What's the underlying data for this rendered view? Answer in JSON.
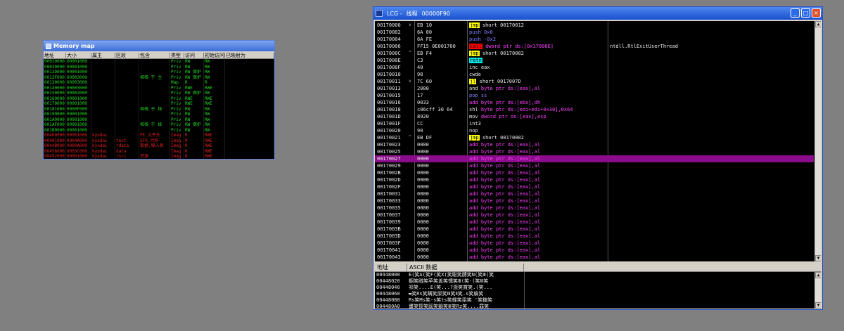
{
  "memory_map": {
    "title": "Memory map",
    "columns": [
      "地址",
      "大小",
      "属主",
      "区段",
      "包含",
      "类型",
      "访问",
      "初始访问",
      "已映射为"
    ],
    "rows": [
      {
        "c": [
          "00010000",
          "00001000",
          "",
          "",
          "",
          "Priv",
          "RW",
          "RW",
          ""
        ],
        "t": "g"
      },
      {
        "c": [
          "00020000",
          "00001000",
          "",
          "",
          "",
          "Priv",
          "RW",
          "RW",
          ""
        ],
        "t": "g"
      },
      {
        "c": [
          "0012D000",
          "00001000",
          "",
          "",
          "",
          "Priv",
          "RW  保护",
          "RW",
          ""
        ],
        "t": "g"
      },
      {
        "c": [
          "0012F000",
          "00003000",
          "",
          "",
          "堆栈 于 主",
          "Priv",
          "RW  保护",
          "RW",
          ""
        ],
        "t": "g"
      },
      {
        "c": [
          "00130000",
          "00003000",
          "",
          "",
          "",
          "Map",
          "R",
          "R",
          ""
        ],
        "t": "g"
      },
      {
        "c": [
          "00140000",
          "00003000",
          "",
          "",
          "",
          "Priv",
          "RWE",
          "RWE",
          ""
        ],
        "t": "g"
      },
      {
        "c": [
          "00150000",
          "00002000",
          "",
          "",
          "",
          "Priv",
          "RW  保护",
          "RW",
          ""
        ],
        "t": "g"
      },
      {
        "c": [
          "00160000",
          "00001000",
          "",
          "",
          "",
          "Priv",
          "RWE",
          "RWE",
          ""
        ],
        "t": "g"
      },
      {
        "c": [
          "00170000",
          "00001000",
          "",
          "",
          "",
          "Priv",
          "RWE",
          "RWE",
          ""
        ],
        "t": "g"
      },
      {
        "c": [
          "00181000",
          "0000F000",
          "",
          "",
          "堆栈 于 线",
          "Priv",
          "RW",
          "RW",
          ""
        ],
        "t": "g"
      },
      {
        "c": [
          "00190000",
          "00001000",
          "",
          "",
          "",
          "Priv",
          "RW",
          "RW",
          ""
        ],
        "t": "g"
      },
      {
        "c": [
          "001A0000",
          "00001000",
          "",
          "",
          "",
          "Priv",
          "RW",
          "RW",
          ""
        ],
        "t": "g"
      },
      {
        "c": [
          "001AF000",
          "00001000",
          "",
          "",
          "堆栈 于 线",
          "Priv",
          "RW  保护",
          "RW",
          ""
        ],
        "t": "g"
      },
      {
        "c": [
          "001B0000",
          "00001000",
          "",
          "",
          "",
          "Priv",
          "RW",
          "RW",
          ""
        ],
        "t": "g"
      },
      {
        "c": [
          "00400000",
          "00001000",
          "kyodai",
          "",
          "PE 文件头",
          "Imag",
          "R",
          "RWE",
          ""
        ],
        "t": "r"
      },
      {
        "c": [
          "00401000",
          "0004A000",
          "kyodai",
          "text",
          "SFX,代码",
          "Imag",
          "R",
          "RWE",
          ""
        ],
        "t": "r"
      },
      {
        "c": [
          "0044B000",
          "0000A000",
          "kyodai",
          "rdata",
          "数据,输入表",
          "Imag",
          "R",
          "RWE",
          ""
        ],
        "t": "r"
      },
      {
        "c": [
          "00456000",
          "0003C000",
          "kyodai",
          "data",
          "",
          "Imag",
          "R",
          "RWE",
          ""
        ],
        "t": "r"
      },
      {
        "c": [
          "00492000",
          "00001000",
          "kyodai",
          "rsrc",
          "资源",
          "Imag",
          "R",
          "RWE",
          ""
        ],
        "t": "r"
      }
    ]
  },
  "cpu": {
    "title_prefix": "LCG -",
    "title_thread": "线程",
    "title_id": "00000F90",
    "buttons": {
      "min": "_",
      "max": "□",
      "close": "×"
    },
    "selected_index": 19,
    "rows": [
      {
        "addr": "00170000",
        "mark": "v",
        "hex": "EB 10",
        "mn": "jmp",
        "cls": "jmp",
        "op": "short 00170012",
        "ocls": "plain",
        "cmt": ""
      },
      {
        "addr": "00170002",
        "mark": "",
        "hex": "6A 00",
        "mn": "push",
        "cls": "push",
        "op": "0x0",
        "ocls": "push",
        "cmt": ""
      },
      {
        "addr": "00170004",
        "mark": "",
        "hex": "6A FE",
        "mn": "push",
        "cls": "push",
        "op": "-0x2",
        "ocls": "push",
        "cmt": ""
      },
      {
        "addr": "00170006",
        "mark": "",
        "hex": "FF15 0E001700",
        "mn": "call",
        "cls": "call",
        "op": "dword ptr ds:[0x17000E]",
        "ocls": "mem",
        "cmt": "ntdll.RtlExitUserThread"
      },
      {
        "addr": "0017000C",
        "mark": "^",
        "hex": "EB F4",
        "mn": "jmp",
        "cls": "jmp",
        "op": "short 00170002",
        "ocls": "plain",
        "cmt": ""
      },
      {
        "addr": "0017000E",
        "mark": "",
        "hex": "C3",
        "mn": "retn",
        "cls": "retn",
        "op": "",
        "ocls": "plain",
        "cmt": ""
      },
      {
        "addr": "0017000F",
        "mark": "",
        "hex": "40",
        "mn": "inc",
        "cls": "plain",
        "op": "eax",
        "ocls": "plain",
        "cmt": ""
      },
      {
        "addr": "00170010",
        "mark": "",
        "hex": "98",
        "mn": "cwde",
        "cls": "plain",
        "op": "",
        "ocls": "plain",
        "cmt": ""
      },
      {
        "addr": "00170011",
        "mark": "v",
        "hex": "7C 60",
        "mn": "jl",
        "cls": "jmp",
        "op": "short 0017007D",
        "ocls": "plain",
        "cmt": ""
      },
      {
        "addr": "00170013",
        "mark": "",
        "hex": "2000",
        "mn": "and",
        "cls": "plain",
        "op": "byte ptr ds:[eax],al",
        "ocls": "mem",
        "cmt": ""
      },
      {
        "addr": "00170015",
        "mark": "",
        "hex": "17",
        "mn": "pop",
        "cls": "push",
        "op": "ss",
        "ocls": "push",
        "cmt": ""
      },
      {
        "addr": "00170016",
        "mark": "",
        "hex": "0033",
        "mn": "add",
        "cls": "add",
        "op": "byte ptr ds:[ebx],dh",
        "ocls": "mem",
        "cmt": ""
      },
      {
        "addr": "00170018",
        "mark": "",
        "hex": "c06cff 30 64",
        "mn": "shl",
        "cls": "plain",
        "op": "byte ptr ds:[edi+edi+0x30],0x64",
        "ocls": "mem",
        "cmt": ""
      },
      {
        "addr": "0017001D",
        "mark": "",
        "hex": "8920",
        "mn": "mov",
        "cls": "plain",
        "op": "dword ptr ds:[eax],esp",
        "ocls": "mem",
        "cmt": ""
      },
      {
        "addr": "0017001F",
        "mark": "",
        "hex": "CC",
        "mn": "int3",
        "cls": "plain",
        "op": "",
        "ocls": "plain",
        "cmt": ""
      },
      {
        "addr": "00170020",
        "mark": "",
        "hex": "90",
        "mn": "nop",
        "cls": "plain",
        "op": "",
        "ocls": "plain",
        "cmt": ""
      },
      {
        "addr": "00170021",
        "mark": "^",
        "hex": "EB DF",
        "mn": "jmp",
        "cls": "jmp",
        "op": "short 00170002",
        "ocls": "plain",
        "cmt": ""
      },
      {
        "addr": "00170023",
        "mark": "",
        "hex": "0000",
        "mn": "add",
        "cls": "add",
        "op": "byte ptr ds:[eax],al",
        "ocls": "mem",
        "cmt": ""
      },
      {
        "addr": "00170025",
        "mark": "",
        "hex": "0000",
        "mn": "add",
        "cls": "add",
        "op": "byte ptr ds:[eax],al",
        "ocls": "mem",
        "cmt": ""
      },
      {
        "addr": "00170027",
        "mark": "",
        "hex": "0000",
        "mn": "add",
        "cls": "add",
        "op": "byte ptr ds:[eax],al",
        "ocls": "mem",
        "cmt": ""
      },
      {
        "addr": "00170029",
        "mark": "",
        "hex": "0000",
        "mn": "add",
        "cls": "add",
        "op": "byte ptr ds:[eax],al",
        "ocls": "mem",
        "cmt": ""
      },
      {
        "addr": "0017002B",
        "mark": "",
        "hex": "0000",
        "mn": "add",
        "cls": "add",
        "op": "byte ptr ds:[eax],al",
        "ocls": "mem",
        "cmt": ""
      },
      {
        "addr": "0017002D",
        "mark": "",
        "hex": "0000",
        "mn": "add",
        "cls": "add",
        "op": "byte ptr ds:[eax],al",
        "ocls": "mem",
        "cmt": ""
      },
      {
        "addr": "0017002F",
        "mark": "",
        "hex": "0000",
        "mn": "add",
        "cls": "add",
        "op": "byte ptr ds:[eax],al",
        "ocls": "mem",
        "cmt": ""
      },
      {
        "addr": "00170031",
        "mark": "",
        "hex": "0000",
        "mn": "add",
        "cls": "add",
        "op": "byte ptr ds:[eax],al",
        "ocls": "mem",
        "cmt": ""
      },
      {
        "addr": "00170033",
        "mark": "",
        "hex": "0000",
        "mn": "add",
        "cls": "add",
        "op": "byte ptr ds:[eax],al",
        "ocls": "mem",
        "cmt": ""
      },
      {
        "addr": "00170035",
        "mark": "",
        "hex": "0000",
        "mn": "add",
        "cls": "add",
        "op": "byte ptr ds:[eax],al",
        "ocls": "mem",
        "cmt": ""
      },
      {
        "addr": "00170037",
        "mark": "",
        "hex": "0000",
        "mn": "add",
        "cls": "add",
        "op": "byte ptr ds:[eax],al",
        "ocls": "mem",
        "cmt": ""
      },
      {
        "addr": "00170039",
        "mark": "",
        "hex": "0000",
        "mn": "add",
        "cls": "add",
        "op": "byte ptr ds:[eax],al",
        "ocls": "mem",
        "cmt": ""
      },
      {
        "addr": "0017003B",
        "mark": "",
        "hex": "0000",
        "mn": "add",
        "cls": "add",
        "op": "byte ptr ds:[eax],al",
        "ocls": "mem",
        "cmt": ""
      },
      {
        "addr": "0017003D",
        "mark": "",
        "hex": "0000",
        "mn": "add",
        "cls": "add",
        "op": "byte ptr ds:[eax],al",
        "ocls": "mem",
        "cmt": ""
      },
      {
        "addr": "0017003F",
        "mark": "",
        "hex": "0000",
        "mn": "add",
        "cls": "add",
        "op": "byte ptr ds:[eax],al",
        "ocls": "mem",
        "cmt": ""
      },
      {
        "addr": "00170041",
        "mark": "",
        "hex": "0000",
        "mn": "add",
        "cls": "add",
        "op": "byte ptr ds:[eax],al",
        "ocls": "mem",
        "cmt": ""
      },
      {
        "addr": "00170043",
        "mark": "",
        "hex": "0000",
        "mn": "add",
        "cls": "add",
        "op": "byte ptr ds:[eax],al",
        "ocls": "mem",
        "cmt": ""
      }
    ]
  },
  "dump": {
    "columns": [
      "地址",
      "ASCII 数据"
    ],
    "rows": [
      {
        "addr": "00448000",
        "ascii": "E(笑A(笑F(笑X(笑聪笑膊笑N(笑Ⅲ(笑"
      },
      {
        "addr": "00448020",
        "ascii": "橱笑贼笑苹笑盖笑懦笑Ⅲ(笑-(笑Ⅲ笑"
      },
      {
        "addr": "00448040",
        "ascii": "祁笑....E(笑...?浙笑賞笑.(笑..."
      },
      {
        "addr": "00448060",
        "ascii": "▬笑Rs笑蹒笑尿笑Ⅲ笑Ⅱ笑.s笑躲笑"
      },
      {
        "addr": "00448080",
        "ascii": "Rs笑Ms笑-s笑ts笑蝶笑梁笑 '笑糖笑"
      },
      {
        "addr": "004480A0",
        "ascii": "畫笑惯笑既笑躺笑Ⅲ笑Rz笑....罪笑"
      }
    ]
  }
}
